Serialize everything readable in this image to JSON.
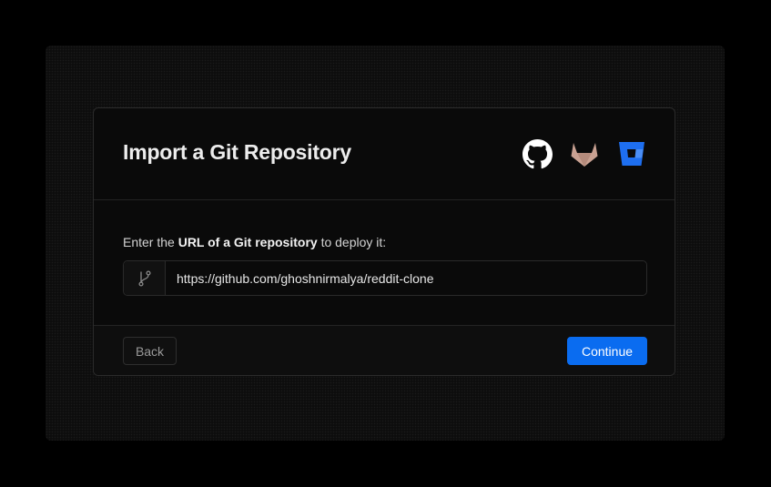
{
  "header": {
    "title": "Import a Git Repository",
    "providers": [
      {
        "name": "GitHub",
        "icon": "github-icon",
        "color": "#ffffff"
      },
      {
        "name": "GitLab",
        "icon": "gitlab-icon",
        "color": "#c9a192"
      },
      {
        "name": "Bitbucket",
        "icon": "bitbucket-icon",
        "color": "#1e6ff0"
      }
    ]
  },
  "form": {
    "prompt_prefix": "Enter the ",
    "prompt_bold": "URL of a Git repository",
    "prompt_suffix": " to deploy it:",
    "prefix_icon": "git-branch-icon",
    "url_value": "https://github.com/ghoshnirmalya/reddit-clone"
  },
  "footer": {
    "back_label": "Back",
    "continue_label": "Continue"
  },
  "colors": {
    "accent": "#0a6cf0",
    "background": "#000000",
    "card": "#0a0a0a"
  }
}
